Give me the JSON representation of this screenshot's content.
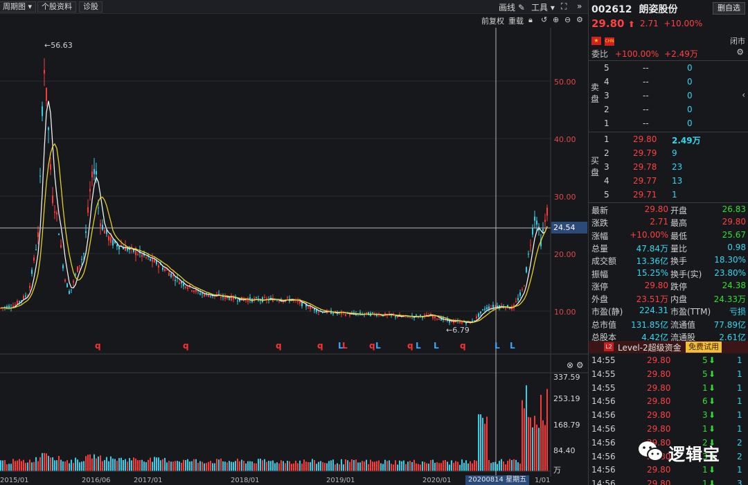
{
  "toolbar": {
    "period_select": "周期图",
    "stock_info_btn": "个股资料",
    "diagnose_btn": "诊股",
    "draw_line_btn": "画线",
    "tools_btn": "工具",
    "forward_adj": "前复权",
    "overlay": "重载"
  },
  "chart": {
    "price_ticks": [
      "50.00",
      "40.00",
      "30.00",
      "20.00",
      "10.00"
    ],
    "crosshair_price": "24.54",
    "high_annot": "←56.63",
    "low_annot": "←6.79",
    "volume_ticks": [
      "337.59",
      "253.19",
      "168.79",
      "84.40"
    ],
    "volume_unit": "万",
    "x_ticks": [
      "2015/01",
      "2016/06",
      "2017/01",
      "2018/01",
      "2019/01",
      "2020/01",
      "1/01"
    ],
    "crosshair_date": "20200814 星期五",
    "signals": [
      {
        "text": "q",
        "color": "#ff3030"
      },
      {
        "text": "q",
        "color": "#ff3030"
      },
      {
        "text": "q",
        "color": "#ff3030"
      },
      {
        "text": "q",
        "color": "#ff3030"
      },
      {
        "text": "L",
        "color": "#30a8ff"
      },
      {
        "text": "L",
        "color": "#ff3030"
      },
      {
        "text": "q",
        "color": "#ff3030"
      },
      {
        "text": "L",
        "color": "#30a8ff"
      },
      {
        "text": "q",
        "color": "#ff3030"
      },
      {
        "text": "L",
        "color": "#30a8ff"
      },
      {
        "text": "L",
        "color": "#30a8ff"
      },
      {
        "text": "q",
        "color": "#ff3030"
      },
      {
        "text": "L",
        "color": "#30a8ff"
      },
      {
        "text": "L",
        "color": "#30a8ff"
      }
    ]
  },
  "quote": {
    "code": "002612",
    "name": "朗姿股份",
    "delete_btn": "删自选",
    "price": "29.80",
    "change": "2.71",
    "change_pct": "+10.00%",
    "flag1": "★",
    "flag2": "CHN",
    "status": "闭市",
    "webi_label": "委比",
    "webi_pct": "+100.00%",
    "webi_diff": "+2.49万",
    "sell_label": "卖盘",
    "buy_label": "买盘",
    "asks": [
      {
        "lvl": "5",
        "price": "--",
        "vol": "0"
      },
      {
        "lvl": "4",
        "price": "--",
        "vol": "0"
      },
      {
        "lvl": "3",
        "price": "--",
        "vol": "0"
      },
      {
        "lvl": "2",
        "price": "--",
        "vol": "0"
      },
      {
        "lvl": "1",
        "price": "--",
        "vol": "0"
      }
    ],
    "bids": [
      {
        "lvl": "1",
        "price": "29.80",
        "vol": "2.49万"
      },
      {
        "lvl": "2",
        "price": "29.79",
        "vol": "9"
      },
      {
        "lvl": "3",
        "price": "29.78",
        "vol": "23"
      },
      {
        "lvl": "4",
        "price": "29.77",
        "vol": "13"
      },
      {
        "lvl": "5",
        "price": "29.71",
        "vol": "1"
      }
    ],
    "stats": [
      {
        "l1": "最新",
        "v1": "29.80",
        "c1": "#ff4040",
        "l2": "开盘",
        "v2": "26.83",
        "c2": "#30e030"
      },
      {
        "l1": "涨跌",
        "v1": "2.71",
        "c1": "#ff4040",
        "l2": "最高",
        "v2": "29.80",
        "c2": "#ff4040"
      },
      {
        "l1": "涨幅",
        "v1": "+10.00%",
        "c1": "#ff4040",
        "l2": "最低",
        "v2": "25.67",
        "c2": "#30e030"
      },
      {
        "l1": "总量",
        "v1": "47.84万",
        "c1": "#30d8f0",
        "l2": "量比",
        "v2": "0.98",
        "c2": "#30d8f0"
      },
      {
        "l1": "成交额",
        "v1": "13.36亿",
        "c1": "#30d8f0",
        "l2": "换手",
        "v2": "18.30%",
        "c2": "#30d8f0"
      },
      {
        "l1": "振幅",
        "v1": "15.25%",
        "c1": "#30d8f0",
        "l2": "换手(实)",
        "v2": "23.80%",
        "c2": "#30d8f0"
      },
      {
        "l1": "涨停",
        "v1": "29.80",
        "c1": "#ff4040",
        "l2": "跌停",
        "v2": "24.38",
        "c2": "#30e030"
      },
      {
        "l1": "外盘",
        "v1": "23.51万",
        "c1": "#ff4040",
        "l2": "内盘",
        "v2": "24.33万",
        "c2": "#30e030"
      },
      {
        "l1": "市盈(静)",
        "v1": "224.31",
        "c1": "#30d8f0",
        "l2": "市盈(TTM)",
        "v2": "亏损",
        "c2": "#30d8f0"
      },
      {
        "l1": "总市值",
        "v1": "131.85亿",
        "c1": "#30d8f0",
        "l2": "流通值",
        "v2": "77.89亿",
        "c2": "#30d8f0"
      },
      {
        "l1": "总股本",
        "v1": "4.42亿",
        "c1": "#30d8f0",
        "l2": "流通股",
        "v2": "2.61亿",
        "c2": "#30d8f0"
      }
    ],
    "level2_badge": "L2",
    "level2_label": "Level-2超级资金",
    "free_trial": "免费试用",
    "ticks": [
      {
        "time": "14:55",
        "price": "29.80",
        "vol": "5",
        "n": "1"
      },
      {
        "time": "14:55",
        "price": "29.80",
        "vol": "5",
        "n": "1"
      },
      {
        "time": "14:55",
        "price": "29.80",
        "vol": "1",
        "n": "1"
      },
      {
        "time": "14:56",
        "price": "29.80",
        "vol": "6",
        "n": "1"
      },
      {
        "time": "14:56",
        "price": "29.80",
        "vol": "3",
        "n": "1"
      },
      {
        "time": "14:56",
        "price": "29.80",
        "vol": "1",
        "n": "1"
      },
      {
        "time": "14:56",
        "price": "29.80",
        "vol": "2",
        "n": "2"
      },
      {
        "time": "14:56",
        "price": "29.80",
        "vol": "3",
        "n": "2"
      },
      {
        "time": "14:56",
        "price": "29.80",
        "vol": "1",
        "n": "1"
      },
      {
        "time": "14:56",
        "price": "29.80",
        "vol": "1",
        "n": "3"
      }
    ]
  },
  "watermark": "逻辑宝"
}
